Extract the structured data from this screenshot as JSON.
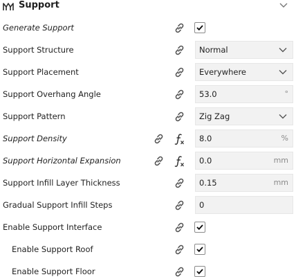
{
  "header": {
    "title": "Support",
    "icon": "support-icon",
    "collapse_icon": "chevron-down-icon"
  },
  "settings": [
    {
      "label": "Generate Support",
      "italic": true,
      "indent": false,
      "type": "checkbox",
      "checked": true,
      "fx": false
    },
    {
      "label": "Support Structure",
      "italic": false,
      "indent": false,
      "type": "dropdown",
      "value": "Normal",
      "fx": false
    },
    {
      "label": "Support Placement",
      "italic": false,
      "indent": false,
      "type": "dropdown",
      "value": "Everywhere",
      "fx": false
    },
    {
      "label": "Support Overhang Angle",
      "italic": false,
      "indent": false,
      "type": "number",
      "value": "53.0",
      "unit": "°",
      "fx": false
    },
    {
      "label": "Support Pattern",
      "italic": false,
      "indent": false,
      "type": "dropdown",
      "value": "Zig Zag",
      "fx": false
    },
    {
      "label": "Support Density",
      "italic": true,
      "indent": false,
      "type": "number",
      "value": "8.0",
      "unit": "%",
      "fx": true
    },
    {
      "label": "Support Horizontal Expansion",
      "italic": true,
      "indent": false,
      "type": "number",
      "value": "0.0",
      "unit": "mm",
      "fx": true
    },
    {
      "label": "Support Infill Layer Thickness",
      "italic": false,
      "indent": false,
      "type": "number",
      "value": "0.15",
      "unit": "mm",
      "fx": false
    },
    {
      "label": "Gradual Support Infill Steps",
      "italic": false,
      "indent": false,
      "type": "number",
      "value": "0",
      "unit": "",
      "fx": false
    },
    {
      "label": "Enable Support Interface",
      "italic": false,
      "indent": false,
      "type": "checkbox",
      "checked": true,
      "fx": false
    },
    {
      "label": "Enable Support Roof",
      "italic": false,
      "indent": true,
      "type": "checkbox",
      "checked": true,
      "fx": false
    },
    {
      "label": "Enable Support Floor",
      "italic": false,
      "indent": true,
      "type": "checkbox",
      "checked": true,
      "fx": false
    }
  ]
}
